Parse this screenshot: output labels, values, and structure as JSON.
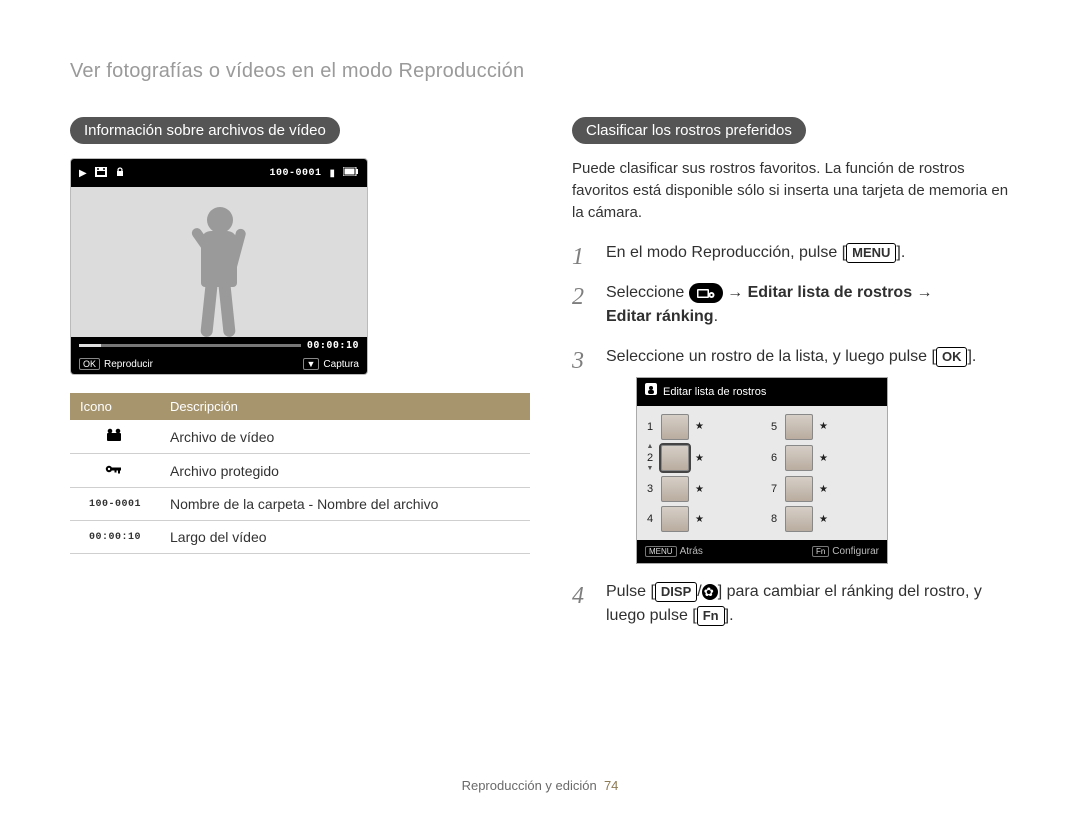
{
  "header": {
    "title": "Ver fotografías o vídeos en el modo Reproducción"
  },
  "left": {
    "pill": "Información sobre archivos de vídeo",
    "lcd": {
      "top_file": "100-0001",
      "timeline_time": "00:00:10",
      "ok_label": "OK",
      "play_label": "Reproducir",
      "down_label": "▼",
      "capture_label": "Captura"
    },
    "table": {
      "head_icon": "Icono",
      "head_desc": "Descripción",
      "rows": [
        {
          "icon_name": "video-file-icon",
          "icon_text": "",
          "desc": "Archivo de vídeo"
        },
        {
          "icon_name": "protected-file-icon",
          "icon_text": "",
          "desc": "Archivo protegido"
        },
        {
          "icon_name": "folder-name-icon",
          "icon_text": "100-0001",
          "desc": "Nombre de la carpeta - Nombre del archivo"
        },
        {
          "icon_name": "length-icon",
          "icon_text": "00:00:10",
          "desc": "Largo del vídeo"
        }
      ]
    }
  },
  "right": {
    "pill": "Clasificar los rostros preferidos",
    "intro": "Puede clasificar sus rostros favoritos. La función de rostros favoritos está disponible sólo si inserta una tarjeta de memoria en la cámara.",
    "steps": {
      "s1_a": "En el modo Reproducción, pulse [",
      "s1_btn": "MENU",
      "s1_b": "].",
      "s2_a": "Seleccione ",
      "s2_arrow": " → ",
      "s2_bold1": "Editar lista de rostros",
      "s2_bold2": "Editar ránking",
      "s2_end": ".",
      "s3_a": "Seleccione un rostro de la lista, y luego pulse [",
      "s3_btn": "OK",
      "s3_b": "].",
      "s4_a": "Pulse [",
      "s4_btn1": "DISP",
      "s4_slash": "/",
      "s4_b": "] para cambiar el ránking del rostro, y luego pulse [",
      "s4_btn2": "Fn",
      "s4_c": "]."
    },
    "facebox": {
      "title": "Editar lista de rostros",
      "numbers_left": [
        "1",
        "2",
        "3",
        "4"
      ],
      "numbers_right": [
        "5",
        "6",
        "7",
        "8"
      ],
      "star": "★",
      "back_key": "MENU",
      "back_label": "Atrás",
      "conf_key": "Fn",
      "conf_label": "Configurar"
    }
  },
  "footer": {
    "text": "Reproducción y edición",
    "page": "74"
  }
}
